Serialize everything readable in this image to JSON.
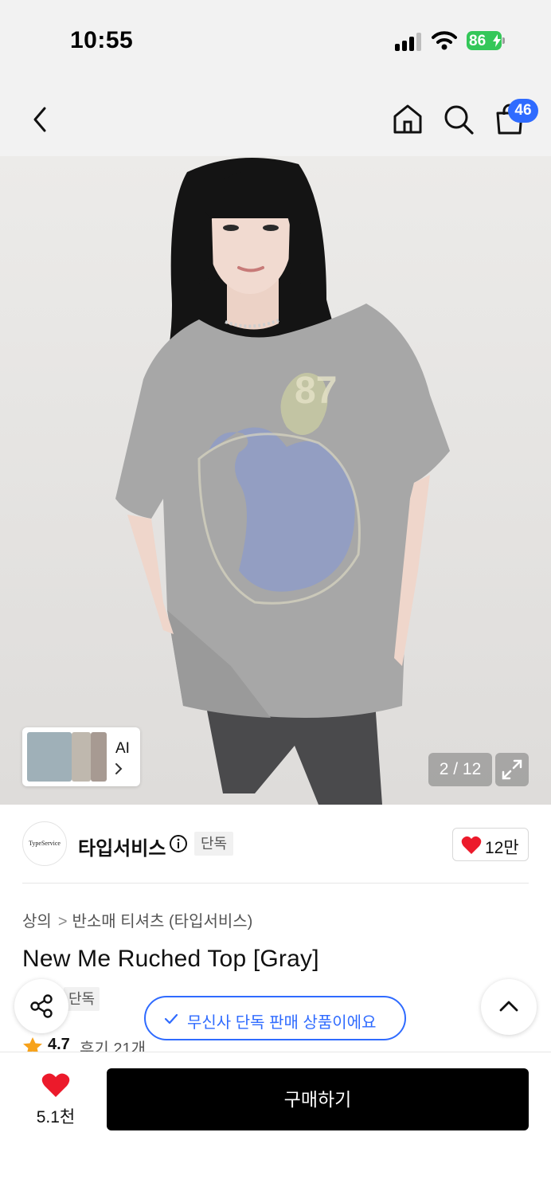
{
  "status_bar": {
    "time": "10:55",
    "battery_percent": "86",
    "battery_color": "#34c759"
  },
  "nav": {
    "back_icon": "chevron-left-icon",
    "home_icon": "home-icon",
    "search_icon": "search-icon",
    "cart_icon": "shopping-bag-icon",
    "cart_badge": "46",
    "badge_color": "#2f6bff"
  },
  "gallery": {
    "ai_label": "AI",
    "counter": "2 / 12",
    "expand_icon": "expand-icon"
  },
  "brand": {
    "logo_text": "TypeService",
    "name": "타입서비스",
    "tag": "단독",
    "like_count": "12만"
  },
  "product": {
    "breadcrumb": [
      "상의",
      "반소매 티셔츠 (타입서비스)"
    ],
    "title": "New Me Ruched Top [Gray]",
    "exclusive_tag": "단독",
    "rating": "4.7",
    "review_text": "후기 21개"
  },
  "floating": {
    "exclusive_notice": "무신사 단독 판매 상품이에요",
    "share_icon": "share-icon",
    "scroll_top_icon": "chevron-up-icon"
  },
  "bottom_bar": {
    "like_count": "5.1천",
    "buy_label": "구매하기",
    "heart_color": "#ec1a2b"
  }
}
